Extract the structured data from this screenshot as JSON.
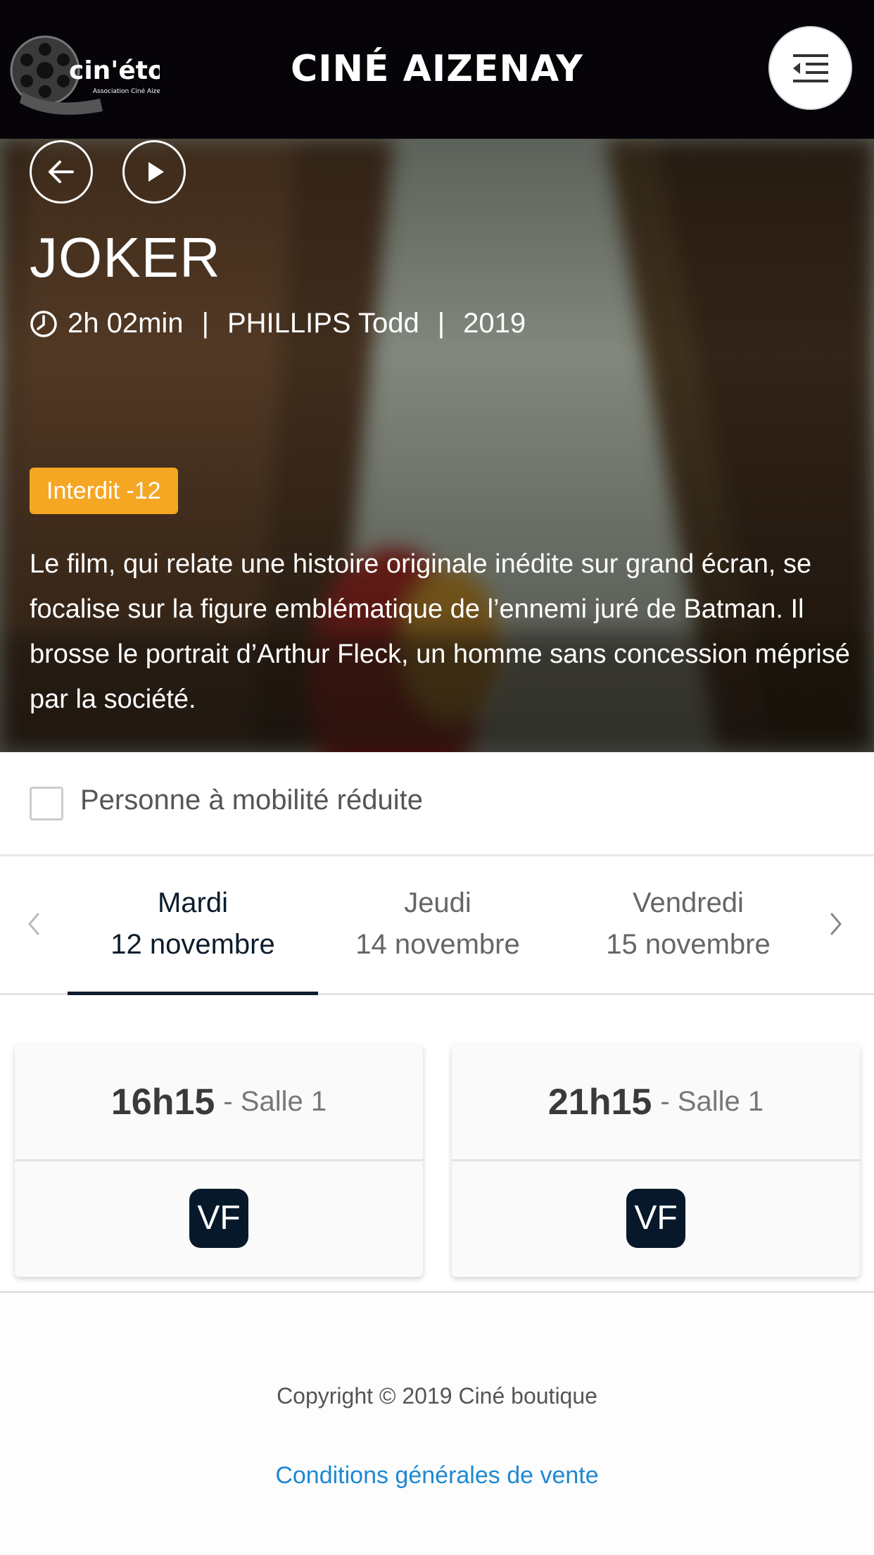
{
  "header": {
    "logo_text": "cin'étoile",
    "logo_subtext": "Association Ciné Aizenay",
    "brand": "CINÉ AIZENAY",
    "menu_icon": "menu-collapse-icon"
  },
  "movie": {
    "title": "JOKER",
    "duration": "2h 02min",
    "director": "PHILLIPS Todd",
    "year": "2019",
    "separator": "|",
    "rating_badge": "Interdit -12",
    "synopsis": "Le film, qui relate une histoire originale inédite sur grand écran, se focalise sur la figure emblématique de l’ennemi juré de Batman. Il brosse le portrait d’Arthur Fleck, un homme sans concession méprisé par la société."
  },
  "filters": {
    "pmr_label": "Personne à mobilité réduite",
    "pmr_checked": false
  },
  "days": [
    {
      "day": "Mardi",
      "date": "12 novembre",
      "active": true
    },
    {
      "day": "Jeudi",
      "date": "14 novembre",
      "active": false
    },
    {
      "day": "Vendredi",
      "date": "15 novembre",
      "active": false
    }
  ],
  "showtimes": [
    {
      "time": "16h15",
      "room": "- Salle 1",
      "version": "VF"
    },
    {
      "time": "21h15",
      "room": "- Salle 1",
      "version": "VF"
    }
  ],
  "footer": {
    "copyright": "Copyright © 2019 Ciné boutique",
    "cgv_link": "Conditions générales de vente"
  },
  "colors": {
    "header_bg": "#060408",
    "badge": "#f5a623",
    "active_tab": "#0c1c2c",
    "vf_badge": "#07182a",
    "link": "#1e88d4"
  }
}
